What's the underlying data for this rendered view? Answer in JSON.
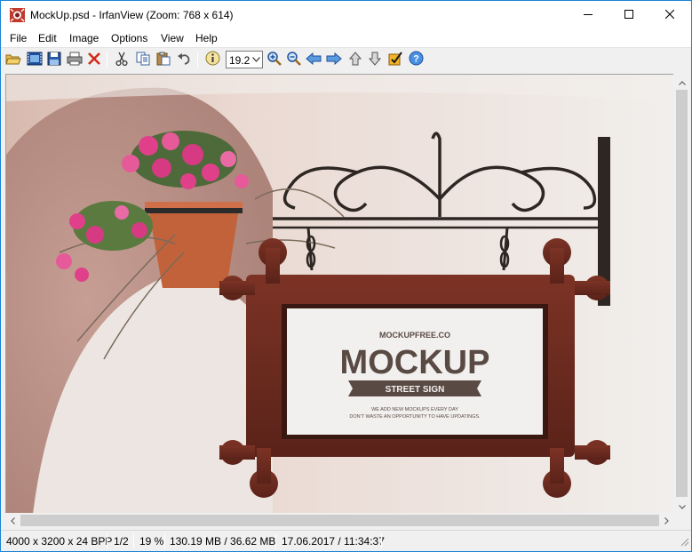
{
  "window": {
    "title": "MockUp.psd - IrfanView (Zoom: 768 x 614)",
    "icons": {
      "minimize": "minimize-icon",
      "maximize": "maximize-icon",
      "close": "close-icon"
    }
  },
  "menu": {
    "items": [
      "File",
      "Edit",
      "Image",
      "Options",
      "View",
      "Help"
    ]
  },
  "toolbar": {
    "zoom_value": "19.2",
    "icons": [
      "open-folder-icon",
      "slideshow-icon",
      "save-icon",
      "print-icon",
      "delete-icon",
      "cut-icon",
      "copy-icon",
      "paste-icon",
      "undo-icon",
      "info-icon",
      "zoom-in-icon",
      "zoom-out-icon",
      "previous-icon",
      "next-icon",
      "first-icon",
      "last-icon",
      "properties-icon",
      "help-icon"
    ]
  },
  "image": {
    "sign_brand": "MOCKUPFREE.CO",
    "sign_title": "MOCKUP",
    "sign_ribbon": "STREET SIGN",
    "sign_tagline_1": "WE ADD NEW MOCKUPS EVERY DAY",
    "sign_tagline_2": "DON'T WASTE AN OPPORTUNITY TO HAVE UPDATINGS.",
    "colors": {
      "wood": "#6b2a20",
      "sign_text": "#5a4a44",
      "wall": "#eeecea"
    }
  },
  "status": {
    "dimensions": "4000 x 3200 x 24 BPP",
    "index": "1/2",
    "zoom": "19 %",
    "memory": "130.19 MB / 36.62 MB",
    "datetime": "17.06.2017 / 11:34:37"
  }
}
